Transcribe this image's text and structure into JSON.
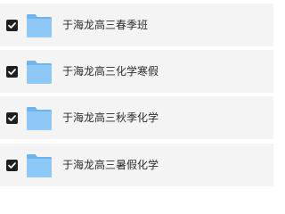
{
  "folders": [
    {
      "name": "于海龙高三春季班",
      "checked": true,
      "icon": "folder-icon"
    },
    {
      "name": "于海龙高三化学寒假",
      "checked": true,
      "icon": "folder-icon"
    },
    {
      "name": "于海龙高三秋季化学",
      "checked": true,
      "icon": "folder-icon"
    },
    {
      "name": "于海龙高三暑假化学",
      "checked": true,
      "icon": "folder-icon"
    }
  ],
  "colors": {
    "row_background": "#f4f4f4",
    "checkbox": "#1f1f1f",
    "folder_front": "#8ec8f6",
    "folder_back": "#6fb4ee"
  }
}
